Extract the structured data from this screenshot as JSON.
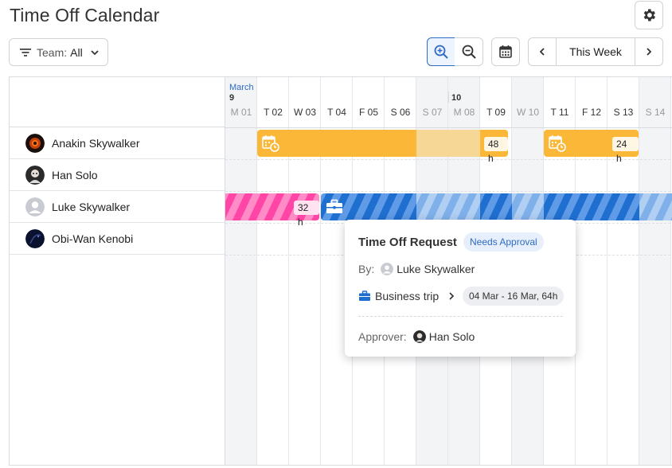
{
  "page": {
    "title": "Time Off Calendar"
  },
  "toolbar": {
    "team_filter_label": "Team:",
    "team_filter_value": "All",
    "week_label": "This Week"
  },
  "calendar": {
    "month": "March",
    "week_numbers": [
      "9",
      "10"
    ],
    "days": [
      {
        "label": "M 01",
        "weekend": true
      },
      {
        "label": "T 02",
        "weekend": false
      },
      {
        "label": "W 03",
        "weekend": false
      },
      {
        "label": "T 04",
        "weekend": false
      },
      {
        "label": "F 05",
        "weekend": false
      },
      {
        "label": "S 06",
        "weekend": false
      },
      {
        "label": "S 07",
        "weekend": true
      },
      {
        "label": "M 08",
        "weekend": true
      },
      {
        "label": "T 09",
        "weekend": false
      },
      {
        "label": "W 10",
        "weekend": true
      },
      {
        "label": "T 11",
        "weekend": false
      },
      {
        "label": "F 12",
        "weekend": false
      },
      {
        "label": "S 13",
        "weekend": false
      },
      {
        "label": "S 14",
        "weekend": true
      }
    ]
  },
  "people": [
    {
      "name": "Anakin Skywalker"
    },
    {
      "name": "Han Solo"
    },
    {
      "name": "Luke Skywalker"
    },
    {
      "name": "Obi-Wan Kenobi"
    }
  ],
  "bars": {
    "anakin_1_hours": "48 h",
    "anakin_2_hours": "24 h",
    "luke_1_hours": "32 h"
  },
  "popup": {
    "title": "Time Off Request",
    "status": "Needs Approval",
    "by_label": "By:",
    "by_name": "Luke Skywalker",
    "type": "Business trip",
    "dates": "04 Mar - 16 Mar, 64h",
    "approver_label": "Approver:",
    "approver_name": "Han Solo"
  },
  "colors": {
    "accent": "#2e6bc4",
    "orange": "#fbb738",
    "pink": "#ff45a5",
    "blue": "#1f6fd0"
  }
}
